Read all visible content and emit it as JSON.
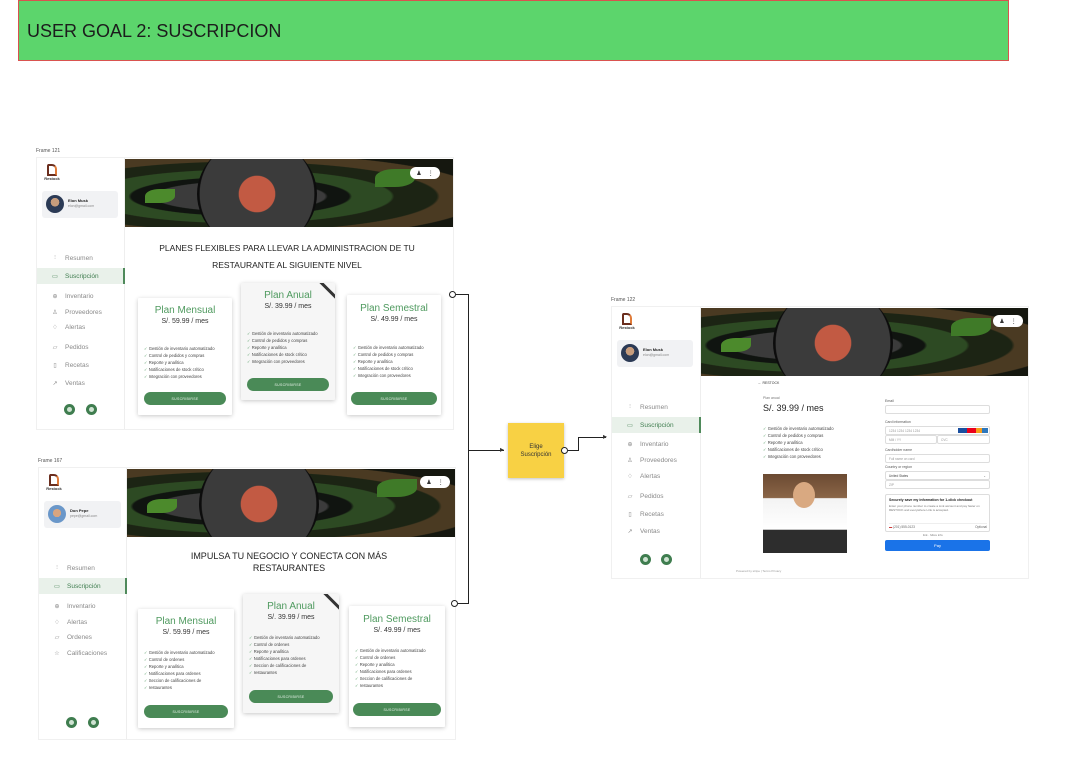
{
  "banner": {
    "title": "USER GOAL 2: SUSCRIPCION"
  },
  "colors": {
    "banner": "#5cd56c",
    "accent_green": "#4f9a5f",
    "sticky": "#f8d144",
    "pay": "#1a73e8"
  },
  "frames": {
    "frame121": {
      "label": "Frame 121",
      "logo": "Restock",
      "user": {
        "name": "Elon Musk",
        "email": "elon@gmail.com"
      },
      "nav": [
        {
          "label": "Resumen",
          "icon": "chart-icon"
        },
        {
          "label": "Suscripción",
          "icon": "card-icon",
          "active": true
        },
        {
          "label": "Inventario",
          "icon": "box-icon"
        },
        {
          "label": "Proveedores",
          "icon": "users-icon"
        },
        {
          "label": "Alertas",
          "icon": "bell-icon"
        },
        {
          "label": "Pedidos",
          "icon": "truck-icon"
        },
        {
          "label": "Recetas",
          "icon": "doc-icon"
        },
        {
          "label": "Ventas",
          "icon": "trend-icon"
        }
      ],
      "heading": "PLANES FLEXIBLES PARA LLEVAR LA ADMINISTRACION DE TU RESTAURANTE AL SIGUIENTE NIVEL",
      "plans": [
        {
          "title": "Plan Mensual",
          "price": "S/. 59.99 / mes",
          "features": [
            "Gestión de inventario automatizado",
            "Control de pedidos y compras",
            "Reporte y analítica",
            "Notificaciones de stock crítico",
            "Integración con proveedores"
          ],
          "button": "SUSCRIBIRSE"
        },
        {
          "title": "Plan Anual",
          "price": "S/. 39.99 / mes",
          "features": [
            "Gestión de inventario automatizado",
            "Control de pedidos y compras",
            "Reporte y analítica",
            "Notificaciones de stock crítico",
            "Integración con proveedores"
          ],
          "button": "SUSCRIBIRSE"
        },
        {
          "title": "Plan Semestral",
          "price": "S/. 49.99 / mes",
          "features": [
            "Gestión de inventario automatizado",
            "Control de pedidos y compras",
            "Reporte y analítica",
            "Notificaciones de stock crítico",
            "Integración con proveedores"
          ],
          "button": "SUSCRIBIRSE"
        }
      ]
    },
    "frame167": {
      "label": "Frame 167",
      "logo": "Restock",
      "user": {
        "name": "Don Pepe",
        "email": "pepe@gmail.com"
      },
      "nav": [
        {
          "label": "Resumen",
          "icon": "chart-icon"
        },
        {
          "label": "Suscripción",
          "icon": "card-icon",
          "active": true
        },
        {
          "label": "Inventario",
          "icon": "box-icon"
        },
        {
          "label": "Alertas",
          "icon": "bell-icon"
        },
        {
          "label": "Ordenes",
          "icon": "truck-icon"
        },
        {
          "label": "Calificaciones",
          "icon": "star-icon"
        }
      ],
      "heading": "IMPULSA TU NEGOCIO Y CONECTA CON MÁS RESTAURANTES",
      "plans": [
        {
          "title": "Plan Mensual",
          "price": "S/. 59.99 / mes",
          "features": [
            "Gestión de inventario automatizado",
            "Control de ordenes",
            "Reporte y analítica",
            "Notificaciones para ordenes",
            "Seccion de calificaciones de",
            "restaurantes"
          ],
          "button": "SUSCRIBIRSE"
        },
        {
          "title": "Plan Anual",
          "price": "S/. 39.99 / mes",
          "features": [
            "Gestión de inventario automatizado",
            "Control de ordenes",
            "Reporte y analítica",
            "Notificaciones para ordenes",
            "Seccion de calificaciones de",
            "restaurantes"
          ],
          "button": "SUSCRIBIRSE"
        },
        {
          "title": "Plan Semestral",
          "price": "S/. 49.99 / mes",
          "features": [
            "Gestión de inventario automatizado",
            "Control de ordenes",
            "Reporte y analítica",
            "Notificaciones para ordenes",
            "Seccion de calificaciones de",
            "restaurantes"
          ],
          "button": "SUSCRIBIRSE"
        }
      ]
    },
    "frame122": {
      "label": "Frame 122",
      "logo": "Restock",
      "user": {
        "name": "Elon Musk",
        "email": "elon@gmail.com"
      },
      "nav": [
        {
          "label": "Resumen",
          "icon": "chart-icon"
        },
        {
          "label": "Suscripción",
          "icon": "card-icon",
          "active": true
        },
        {
          "label": "Inventario",
          "icon": "box-icon"
        },
        {
          "label": "Proveedores",
          "icon": "users-icon"
        },
        {
          "label": "Alertas",
          "icon": "bell-icon"
        },
        {
          "label": "Pedidos",
          "icon": "truck-icon"
        },
        {
          "label": "Recetas",
          "icon": "doc-icon"
        },
        {
          "label": "Ventas",
          "icon": "trend-icon"
        }
      ],
      "checkout": {
        "brand": "RESTOCK",
        "plan_label": "Plan anual",
        "price": "S/. 39.99 / mes",
        "features": [
          "Gestión de inventario automatizado",
          "Control de pedidos y compras",
          "Reporte y analítica",
          "Notificaciones de stock crítico",
          "Integración con proveedores"
        ],
        "email_label": "Email",
        "card_label": "Card information",
        "card_placeholder": "1234 1234 1234 1234",
        "expiry_placeholder": "MM / YY",
        "cvc_placeholder": "CVC",
        "cardholder_label": "Cardholder name",
        "cardholder_placeholder": "Full name on card",
        "country_label": "Country or region",
        "country_value": "United States",
        "zip_placeholder": "ZIP",
        "save_title": "Securely save my information for 1-click checkout",
        "save_desc": "Enter your phone number to create a Link account and pay faster on RESTOCK and everywhere Link is accepted.",
        "phone_value": "(201) 555-0123",
        "optional": "Optional",
        "link_text": "link",
        "more_info": "More info",
        "pay_label": "Pay",
        "footer": "Powered by stripe  |  Terms  Privacy"
      }
    }
  },
  "sticky": {
    "line1": "Elige",
    "line2": "Suscripción"
  }
}
